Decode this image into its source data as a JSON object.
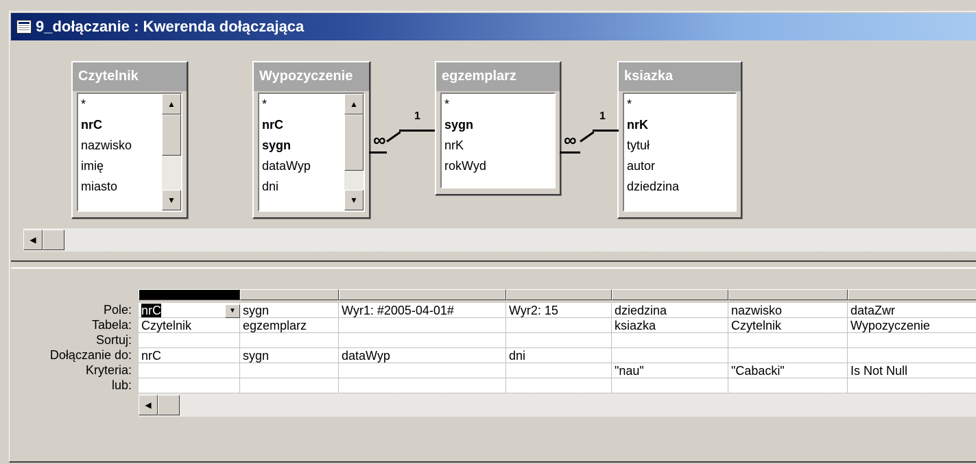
{
  "window": {
    "title": "9_dołączanie : Kwerenda dołączająca"
  },
  "colors": {
    "title_start": "#0a246a",
    "title_end": "#a6caf0",
    "inactive_header": "#a6a6a6"
  },
  "tables": [
    {
      "name": "Czytelnik",
      "fields": [
        {
          "label": "*"
        },
        {
          "label": "nrC",
          "key": true
        },
        {
          "label": "nazwisko"
        },
        {
          "label": "imię"
        },
        {
          "label": "miasto"
        }
      ],
      "scrollbar": true
    },
    {
      "name": "Wypozyczenie",
      "fields": [
        {
          "label": "*"
        },
        {
          "label": "nrC",
          "key": true
        },
        {
          "label": "sygn",
          "key": true
        },
        {
          "label": "dataWyp"
        },
        {
          "label": "dni"
        }
      ],
      "scrollbar": true
    },
    {
      "name": "egzemplarz",
      "fields": [
        {
          "label": "*"
        },
        {
          "label": "sygn",
          "key": true
        },
        {
          "label": "nrK"
        },
        {
          "label": "rokWyd"
        }
      ],
      "scrollbar": false
    },
    {
      "name": "ksiazka",
      "fields": [
        {
          "label": "*"
        },
        {
          "label": "nrK",
          "key": true
        },
        {
          "label": "tytuł"
        },
        {
          "label": "autor"
        },
        {
          "label": "dziedzina"
        }
      ],
      "scrollbar": false
    }
  ],
  "joins": [
    {
      "many": "∞",
      "one": "1"
    },
    {
      "many": "∞",
      "one": "1"
    }
  ],
  "grid": {
    "row_labels": [
      "Pole:",
      "Tabela:",
      "Sortuj:",
      "Dołączanie do:",
      "Kryteria:",
      "lub:"
    ],
    "columns": [
      {
        "pole": "nrC",
        "tabela": "Czytelnik",
        "sortuj": "",
        "dolaczanie": "nrC",
        "kryteria": "",
        "lub": ""
      },
      {
        "pole": "sygn",
        "tabela": "egzemplarz",
        "sortuj": "",
        "dolaczanie": "sygn",
        "kryteria": "",
        "lub": ""
      },
      {
        "pole": "Wyr1: #2005-04-01#",
        "tabela": "",
        "sortuj": "",
        "dolaczanie": "dataWyp",
        "kryteria": "",
        "lub": ""
      },
      {
        "pole": "Wyr2: 15",
        "tabela": "",
        "sortuj": "",
        "dolaczanie": "dni",
        "kryteria": "",
        "lub": ""
      },
      {
        "pole": "dziedzina",
        "tabela": "ksiazka",
        "sortuj": "",
        "dolaczanie": "",
        "kryteria": "\"nau\"",
        "lub": ""
      },
      {
        "pole": "nazwisko",
        "tabela": "Czytelnik",
        "sortuj": "",
        "dolaczanie": "",
        "kryteria": "\"Cabacki\"",
        "lub": ""
      },
      {
        "pole": "dataZwr",
        "tabela": "Wypozyczenie",
        "sortuj": "",
        "dolaczanie": "",
        "kryteria": "Is Not Null",
        "lub": ""
      }
    ]
  },
  "icons": {
    "window": "query-icon",
    "scroll_up": "▲",
    "scroll_down": "▼",
    "scroll_left": "◀",
    "dropdown": "▼"
  }
}
